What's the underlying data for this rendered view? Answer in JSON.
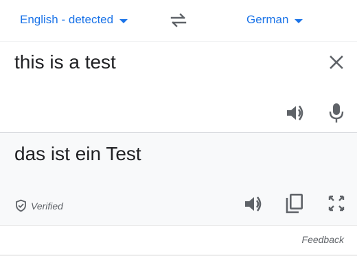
{
  "lang_bar": {
    "source_language": "English - detected",
    "target_language": "German",
    "source_caret_icon": "caret-down",
    "target_caret_icon": "caret-down",
    "swap_icon": "swap-arrows"
  },
  "source": {
    "text": "this is a test",
    "clear_icon": "close",
    "speak_icon": "volume-up",
    "mic_icon": "microphone"
  },
  "target": {
    "text": "das ist ein Test",
    "verified_label": "Verified",
    "verified_icon": "shield-check",
    "speak_icon": "volume-up",
    "copy_icon": "copy",
    "fullscreen_icon": "fullscreen"
  },
  "footer": {
    "feedback_label": "Feedback"
  },
  "colors": {
    "accent": "#1a73e8",
    "icon": "#5f6368",
    "text": "#202124",
    "target_bg": "#f8f9fa"
  }
}
